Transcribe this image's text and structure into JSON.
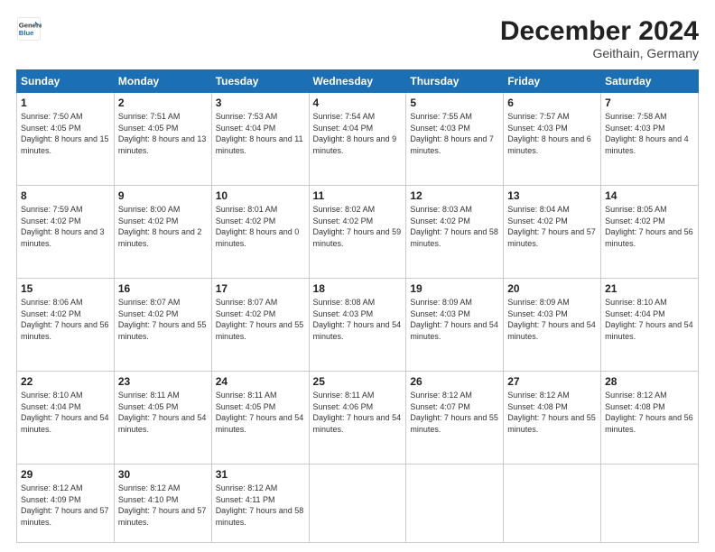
{
  "logo": {
    "line1": "General",
    "line2": "Blue"
  },
  "header": {
    "month": "December 2024",
    "location": "Geithain, Germany"
  },
  "weekdays": [
    "Sunday",
    "Monday",
    "Tuesday",
    "Wednesday",
    "Thursday",
    "Friday",
    "Saturday"
  ],
  "rows": [
    [
      {
        "num": "1",
        "sr": "7:50 AM",
        "ss": "4:05 PM",
        "dl": "8 hours and 15 minutes."
      },
      {
        "num": "2",
        "sr": "7:51 AM",
        "ss": "4:05 PM",
        "dl": "8 hours and 13 minutes."
      },
      {
        "num": "3",
        "sr": "7:53 AM",
        "ss": "4:04 PM",
        "dl": "8 hours and 11 minutes."
      },
      {
        "num": "4",
        "sr": "7:54 AM",
        "ss": "4:04 PM",
        "dl": "8 hours and 9 minutes."
      },
      {
        "num": "5",
        "sr": "7:55 AM",
        "ss": "4:03 PM",
        "dl": "8 hours and 7 minutes."
      },
      {
        "num": "6",
        "sr": "7:57 AM",
        "ss": "4:03 PM",
        "dl": "8 hours and 6 minutes."
      },
      {
        "num": "7",
        "sr": "7:58 AM",
        "ss": "4:03 PM",
        "dl": "8 hours and 4 minutes."
      }
    ],
    [
      {
        "num": "8",
        "sr": "7:59 AM",
        "ss": "4:02 PM",
        "dl": "8 hours and 3 minutes."
      },
      {
        "num": "9",
        "sr": "8:00 AM",
        "ss": "4:02 PM",
        "dl": "8 hours and 2 minutes."
      },
      {
        "num": "10",
        "sr": "8:01 AM",
        "ss": "4:02 PM",
        "dl": "8 hours and 0 minutes."
      },
      {
        "num": "11",
        "sr": "8:02 AM",
        "ss": "4:02 PM",
        "dl": "7 hours and 59 minutes."
      },
      {
        "num": "12",
        "sr": "8:03 AM",
        "ss": "4:02 PM",
        "dl": "7 hours and 58 minutes."
      },
      {
        "num": "13",
        "sr": "8:04 AM",
        "ss": "4:02 PM",
        "dl": "7 hours and 57 minutes."
      },
      {
        "num": "14",
        "sr": "8:05 AM",
        "ss": "4:02 PM",
        "dl": "7 hours and 56 minutes."
      }
    ],
    [
      {
        "num": "15",
        "sr": "8:06 AM",
        "ss": "4:02 PM",
        "dl": "7 hours and 56 minutes."
      },
      {
        "num": "16",
        "sr": "8:07 AM",
        "ss": "4:02 PM",
        "dl": "7 hours and 55 minutes."
      },
      {
        "num": "17",
        "sr": "8:07 AM",
        "ss": "4:02 PM",
        "dl": "7 hours and 55 minutes."
      },
      {
        "num": "18",
        "sr": "8:08 AM",
        "ss": "4:03 PM",
        "dl": "7 hours and 54 minutes."
      },
      {
        "num": "19",
        "sr": "8:09 AM",
        "ss": "4:03 PM",
        "dl": "7 hours and 54 minutes."
      },
      {
        "num": "20",
        "sr": "8:09 AM",
        "ss": "4:03 PM",
        "dl": "7 hours and 54 minutes."
      },
      {
        "num": "21",
        "sr": "8:10 AM",
        "ss": "4:04 PM",
        "dl": "7 hours and 54 minutes."
      }
    ],
    [
      {
        "num": "22",
        "sr": "8:10 AM",
        "ss": "4:04 PM",
        "dl": "7 hours and 54 minutes."
      },
      {
        "num": "23",
        "sr": "8:11 AM",
        "ss": "4:05 PM",
        "dl": "7 hours and 54 minutes."
      },
      {
        "num": "24",
        "sr": "8:11 AM",
        "ss": "4:05 PM",
        "dl": "7 hours and 54 minutes."
      },
      {
        "num": "25",
        "sr": "8:11 AM",
        "ss": "4:06 PM",
        "dl": "7 hours and 54 minutes."
      },
      {
        "num": "26",
        "sr": "8:12 AM",
        "ss": "4:07 PM",
        "dl": "7 hours and 55 minutes."
      },
      {
        "num": "27",
        "sr": "8:12 AM",
        "ss": "4:08 PM",
        "dl": "7 hours and 55 minutes."
      },
      {
        "num": "28",
        "sr": "8:12 AM",
        "ss": "4:08 PM",
        "dl": "7 hours and 56 minutes."
      }
    ],
    [
      {
        "num": "29",
        "sr": "8:12 AM",
        "ss": "4:09 PM",
        "dl": "7 hours and 57 minutes."
      },
      {
        "num": "30",
        "sr": "8:12 AM",
        "ss": "4:10 PM",
        "dl": "7 hours and 57 minutes."
      },
      {
        "num": "31",
        "sr": "8:12 AM",
        "ss": "4:11 PM",
        "dl": "7 hours and 58 minutes."
      },
      null,
      null,
      null,
      null
    ]
  ]
}
